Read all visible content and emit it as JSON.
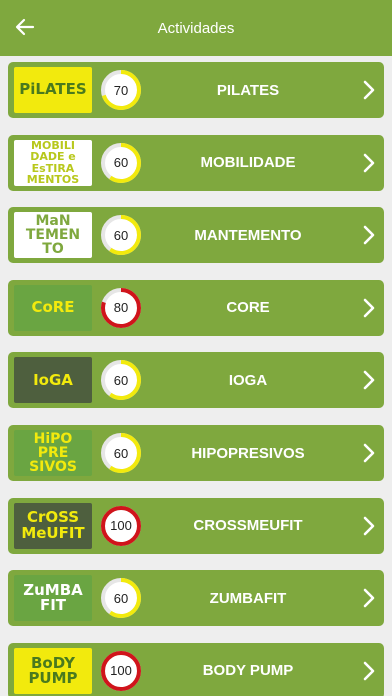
{
  "appbar": {
    "title": "Actividades",
    "back_icon": "arrow-left-icon"
  },
  "colors": {
    "bar": "#7fa83e",
    "row": "#7fa83e",
    "gauge_yellow": "#f2ea0d",
    "gauge_red": "#d0141b",
    "gauge_track": "#e6e6e6"
  },
  "activities": [
    {
      "name": "PILATES",
      "value": 70,
      "thumb_text": "PiLATES",
      "thumb_bg": "#f2ea0d",
      "thumb_fg": "#4a7a1e",
      "gauge_color": "yellow",
      "fraction": 0.7
    },
    {
      "name": "MOBILIDADE",
      "value": 60,
      "thumb_text": "MOBILI\nDADE e\nEsTIRA\nMENTOS",
      "thumb_bg": "#ffffff",
      "thumb_fg": "#b8c81c",
      "gauge_color": "yellow",
      "fraction": 0.6
    },
    {
      "name": "MANTEMENTO",
      "value": 60,
      "thumb_text": "MaN\nTEMEN\nTO",
      "thumb_bg": "#ffffff",
      "thumb_fg": "#7fa83e",
      "gauge_color": "yellow",
      "fraction": 0.6
    },
    {
      "name": "CORE",
      "value": 80,
      "thumb_text": "CoRE",
      "thumb_bg": "#6aa542",
      "thumb_fg": "#f2ea0d",
      "gauge_color": "red",
      "fraction": 0.8
    },
    {
      "name": "IOGA",
      "value": 60,
      "thumb_text": "IoGA",
      "thumb_bg": "#4e5f3e",
      "thumb_fg": "#f2ea0d",
      "gauge_color": "yellow",
      "fraction": 0.6
    },
    {
      "name": "HIPOPRESIVOS",
      "value": 60,
      "thumb_text": "HiPO\nPRE\nSIVOS",
      "thumb_bg": "#6aa542",
      "thumb_fg": "#f2ea0d",
      "gauge_color": "yellow",
      "fraction": 0.6
    },
    {
      "name": "CROSSMEUFIT",
      "value": 100,
      "thumb_text": "CrOSS\nMeUFIT",
      "thumb_bg": "#4e5f3e",
      "thumb_fg": "#f2ea0d",
      "gauge_color": "red",
      "fraction": 1.0
    },
    {
      "name": "ZUMBAFIT",
      "value": 60,
      "thumb_text": "ZuMBA\nFIT",
      "thumb_bg": "#6aa542",
      "thumb_fg": "#ffffff",
      "gauge_color": "yellow",
      "fraction": 0.6
    },
    {
      "name": "BODY PUMP",
      "value": 100,
      "thumb_text": "BoDY\nPUMP",
      "thumb_bg": "#f2ea0d",
      "thumb_fg": "#4a7a1e",
      "gauge_color": "red",
      "fraction": 1.0
    }
  ]
}
